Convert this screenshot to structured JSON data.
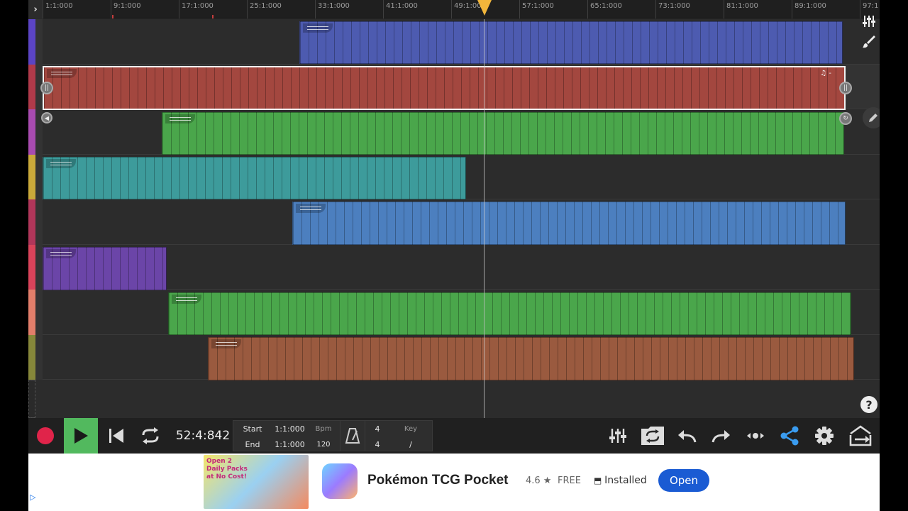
{
  "ruler": {
    "toggle_glyph": "›",
    "ticks": [
      "1:1:000",
      "9:1:000",
      "17:1:000",
      "25:1:000",
      "33:1:000",
      "41:1:000",
      "49:1:00",
      "57:1:000",
      "65:1:000",
      "73:1:000",
      "81:1:000",
      "89:1:000",
      "97:1"
    ]
  },
  "colors": {
    "track_bar": [
      "#5b44c4",
      "#b03a4a",
      "#a84bb0",
      "#caa93a",
      "#b0365a",
      "#d9435a",
      "#e27e6a",
      "#86873a"
    ],
    "clip_fill": [
      "#4d5bb0",
      "#a3473f",
      "#4aa64b",
      "#3d9b9b",
      "#4c7fbf",
      "#6b45a8",
      "#4aa64b",
      "#9a5a3f"
    ],
    "play_button": "#52b95e",
    "record": "#e0244a",
    "share": "#3a9cf0",
    "ad_open": "#1a5bd3"
  },
  "side_icons": [
    "mixer-icon",
    "brush-icon",
    "edit-icon",
    "help-icon"
  ],
  "transport": {
    "time": "52:4:842",
    "start_label": "Start",
    "start_value": "1:1:000",
    "end_label": "End",
    "end_value": "1:1:000",
    "bpm_label": "Bpm",
    "bpm_value": "120",
    "sig_top": "4",
    "sig_bottom": "4",
    "key_label": "Key",
    "key_value": "/"
  },
  "toolbar_icons": [
    "mixer-icon",
    "loop-record-icon",
    "undo-icon",
    "redo-icon",
    "more-icon",
    "share-icon",
    "settings-icon",
    "export-icon"
  ],
  "clip_badge": "♫ -",
  "help_glyph": "?",
  "ad": {
    "banner_text": "Open 2 Daily Packs at No Cost!",
    "title": "Pokémon TCG Pocket",
    "rating": "4.6 ★",
    "price": "FREE",
    "installed": "Installed",
    "open_label": "Open"
  }
}
